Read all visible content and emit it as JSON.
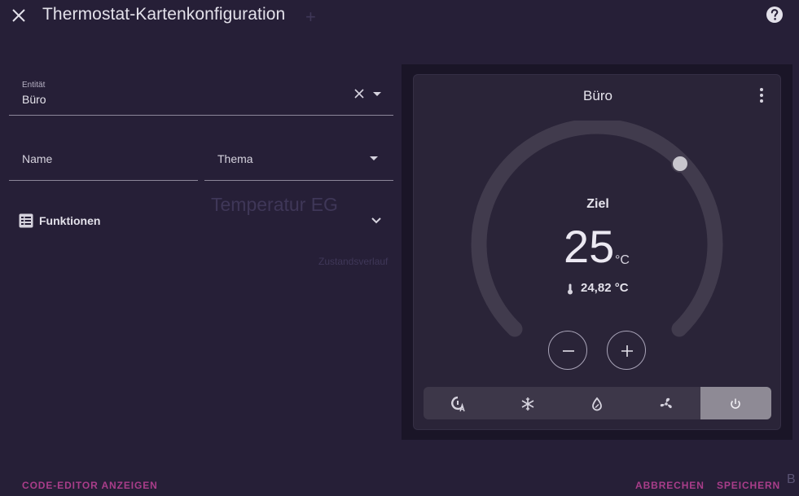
{
  "dialog": {
    "title": "Thermostat-Kartenkonfiguration"
  },
  "background": {
    "ghost_title": "Temperatur EG",
    "ghost_subtitle": "Zustandsverlauf",
    "ghost_plus": "+",
    "ghost_edge_letter": "B"
  },
  "form": {
    "entity": {
      "label": "Entität",
      "value": "Büro"
    },
    "name": {
      "label": "Name"
    },
    "theme": {
      "label": "Thema"
    },
    "features": {
      "label": "Funktionen"
    }
  },
  "preview": {
    "card_name": "Büro",
    "target_label": "Ziel",
    "target_temperature": "25",
    "unit": "°C",
    "current_temperature": "24,82 °C",
    "modes": [
      "heat-cool-icon",
      "snowflake-icon",
      "water-drop-icon",
      "fan-icon",
      "power-icon"
    ],
    "active_mode_index": 4
  },
  "footer": {
    "code_editor": "CODE-EDITOR ANZEIGEN",
    "cancel": "ABBRECHEN",
    "save": "SPEICHERN"
  },
  "colors": {
    "background": "#261f37",
    "accent": "#a93d8a",
    "card": "#2a2438",
    "dial_track": "#413b4d",
    "active_mode": "#8e8a95"
  }
}
